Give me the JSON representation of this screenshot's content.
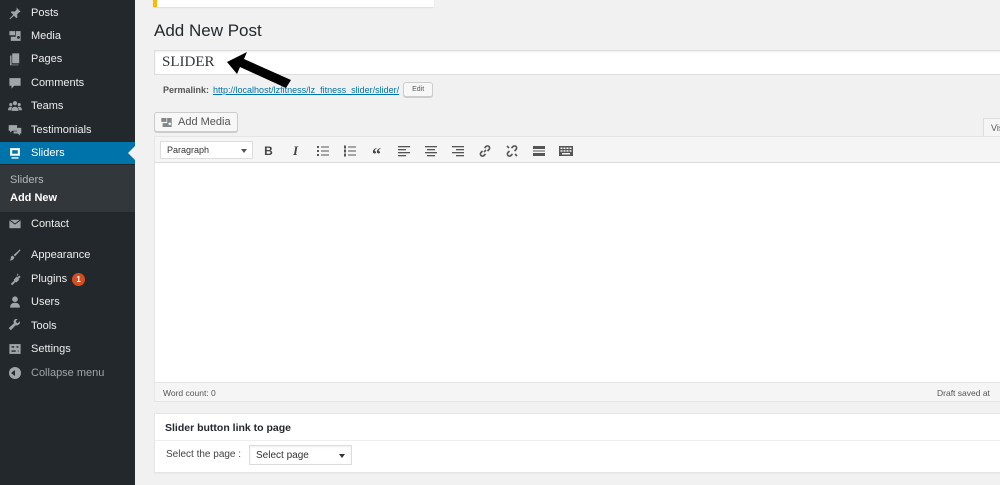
{
  "sidebar": {
    "items": [
      {
        "name": "menu-posts",
        "icon": "pushpin-icon",
        "label": "Posts"
      },
      {
        "name": "menu-media",
        "icon": "media-icon",
        "label": "Media"
      },
      {
        "name": "menu-pages",
        "icon": "pages-icon",
        "label": "Pages"
      },
      {
        "name": "menu-comments",
        "icon": "comment-icon",
        "label": "Comments"
      },
      {
        "name": "menu-teams",
        "icon": "groups-icon",
        "label": "Teams"
      },
      {
        "name": "menu-testimonials",
        "icon": "testimonial-icon",
        "label": "Testimonials"
      },
      {
        "name": "menu-sliders",
        "icon": "slides-icon",
        "label": "Sliders",
        "active": true
      }
    ],
    "submenu": [
      {
        "label": "Sliders"
      },
      {
        "label": "Add New",
        "current": true
      }
    ],
    "items_after": [
      {
        "name": "menu-contact",
        "icon": "email-icon",
        "label": "Contact"
      },
      {
        "name": "menu-appearance",
        "icon": "paintbrush-icon",
        "label": "Appearance"
      },
      {
        "name": "menu-plugins",
        "icon": "plugin-icon",
        "label": "Plugins",
        "badge": "1"
      },
      {
        "name": "menu-users",
        "icon": "user-icon",
        "label": "Users"
      },
      {
        "name": "menu-tools",
        "icon": "wrench-icon",
        "label": "Tools"
      },
      {
        "name": "menu-settings",
        "icon": "settings-icon",
        "label": "Settings"
      }
    ],
    "collapse_label": "Collapse menu"
  },
  "page": {
    "title": "Add New Post",
    "post_title_value": "SLIDER",
    "permalink_label": "Permalink:",
    "permalink_url": "http://localhost/lzfitness/lz_fitness_slider/slider/",
    "edit_label": "Edit"
  },
  "editor": {
    "add_media_label": "Add Media",
    "visual_tab_label": "Visual",
    "format_value": "Paragraph",
    "toolbar_icons": [
      "bold-icon",
      "italic-icon",
      "bulleted-list-icon",
      "numbered-list-icon",
      "blockquote-icon",
      "align-left-icon",
      "align-center-icon",
      "align-right-icon",
      "link-icon",
      "unlink-icon",
      "read-more-icon",
      "toolbar-toggle-icon"
    ],
    "word_count": "Word count: 0",
    "draft_saved": "Draft saved at"
  },
  "metabox": {
    "title": "Slider button link to page",
    "select_label": "Select the page :",
    "select_value": "Select page"
  },
  "colors": {
    "sidebar_bg": "#23282d",
    "active_bg": "#0073aa",
    "badge": "#d54e21",
    "link": "#0073aa",
    "notice": "#ffb900"
  }
}
